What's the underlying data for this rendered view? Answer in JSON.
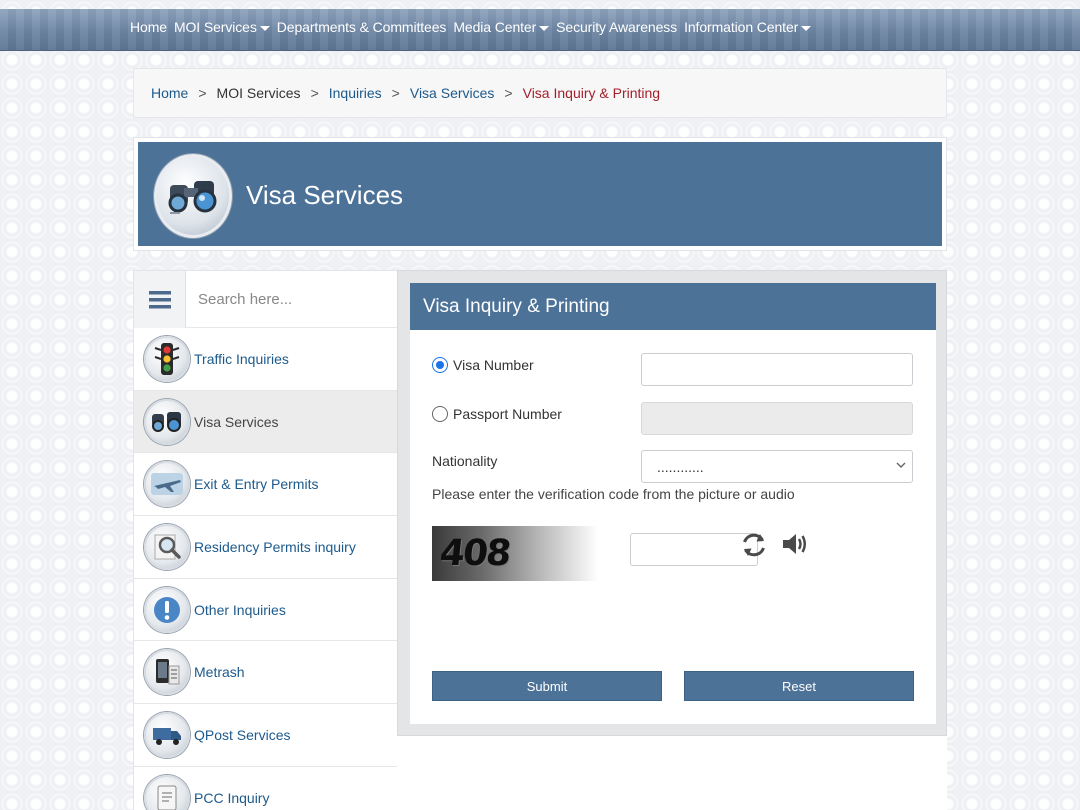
{
  "nav": {
    "items": [
      {
        "label": "Home",
        "dropdown": false
      },
      {
        "label": "MOI Services",
        "dropdown": true
      },
      {
        "label": "Departments & Committees",
        "dropdown": false
      },
      {
        "label": "Media Center",
        "dropdown": true
      },
      {
        "label": "Security Awareness",
        "dropdown": false
      },
      {
        "label": "Information Center",
        "dropdown": true
      }
    ]
  },
  "breadcrumb": {
    "items": [
      "Home",
      "MOI Services",
      "Inquiries",
      "Visa Services",
      "Visa Inquiry & Printing"
    ],
    "separator": ">"
  },
  "banner": {
    "title": "Visa Services",
    "icon": "binoculars-icon"
  },
  "sidebar": {
    "search_placeholder": "Search here...",
    "items": [
      {
        "label": "Traffic Inquiries",
        "icon": "traffic-light-icon",
        "active": false
      },
      {
        "label": "Visa Services",
        "icon": "binoculars-icon",
        "active": true
      },
      {
        "label": "Exit & Entry Permits",
        "icon": "airplane-icon",
        "active": false
      },
      {
        "label": "Residency Permits inquiry",
        "icon": "magnifier-icon",
        "active": false
      },
      {
        "label": "Other Inquiries",
        "icon": "exclamation-icon",
        "active": false
      },
      {
        "label": "Metrash",
        "icon": "phone-icon",
        "active": false
      },
      {
        "label": "QPost Services",
        "icon": "truck-icon",
        "active": false
      },
      {
        "label": "PCC Inquiry",
        "icon": "document-icon",
        "active": false
      }
    ]
  },
  "form": {
    "title": "Visa Inquiry & Printing",
    "visa_number_label": "Visa Number",
    "visa_number_value": "",
    "visa_number_selected": true,
    "passport_number_label": "Passport Number",
    "passport_number_value": "",
    "nationality_label": "Nationality",
    "nationality_selected": "............",
    "verification_hint": "Please enter the verification code from the picture or audio",
    "captcha_text": "408",
    "captcha_input_value": "",
    "submit_label": "Submit",
    "reset_label": "Reset"
  },
  "colors": {
    "brand_blue": "#4d7298",
    "link_blue": "#1d5a8c",
    "current_crumb": "#a3202b",
    "nav_bar": "#6c84a3"
  }
}
